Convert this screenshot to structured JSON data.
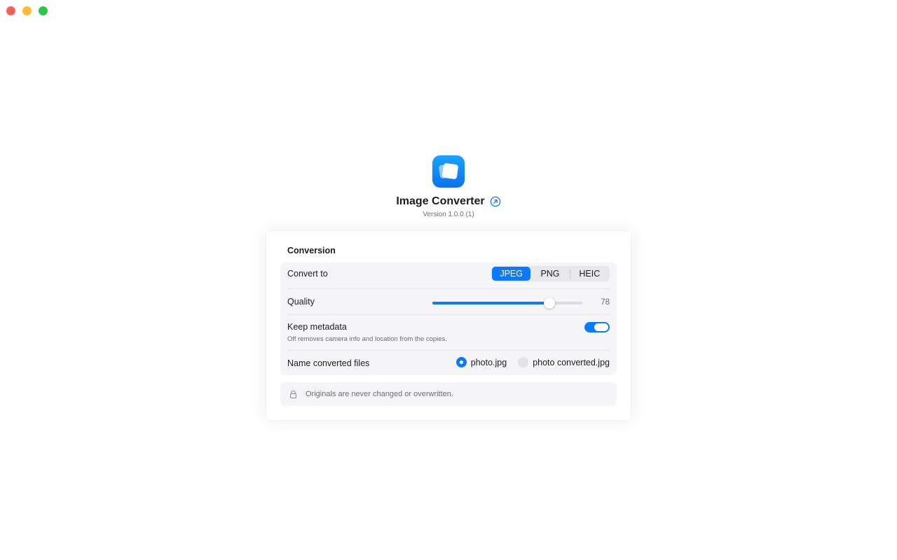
{
  "window": {
    "controls": [
      {
        "name": "close",
        "color": "#ff5f57"
      },
      {
        "name": "minimize",
        "color": "#febc2e"
      },
      {
        "name": "zoom",
        "color": "#28c840"
      }
    ]
  },
  "app": {
    "icon": "stacked-photos-icon",
    "title": "Image Converter",
    "title_link_icon": "external-link-icon",
    "version": "Version 1.0.0 (1)"
  },
  "conversion": {
    "section_title": "Conversion",
    "convert_to": {
      "label": "Convert to",
      "options": [
        "JPEG",
        "PNG",
        "HEIC"
      ],
      "selected": "JPEG"
    },
    "quality": {
      "label": "Quality",
      "value": 78,
      "min": 0,
      "max": 100,
      "display": "78"
    },
    "keep_metadata": {
      "label": "Keep metadata",
      "hint": "Off removes camera info and location from the copies.",
      "enabled": true
    },
    "naming": {
      "label": "Name converted files",
      "options": [
        "photo.jpg",
        "photo converted.jpg"
      ],
      "selected": "photo.jpg"
    }
  },
  "notice": {
    "icon": "lock-icon",
    "text": "Originals are never changed or overwritten."
  },
  "colors": {
    "accent": "#0a7aff",
    "group_bg": "#f5f5f7",
    "secondary_text": "#6e6e73"
  }
}
